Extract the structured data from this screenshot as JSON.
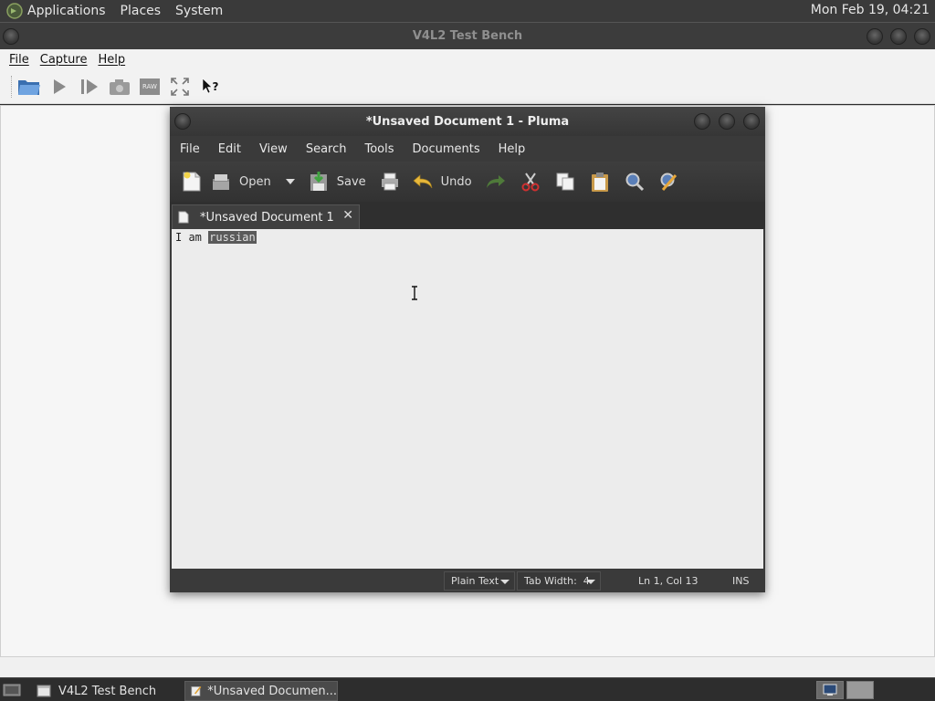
{
  "top_panel": {
    "applications": "Applications",
    "places": "Places",
    "system": "System",
    "clock": "Mon Feb 19, 04:21"
  },
  "v4l2": {
    "title": "V4L2 Test Bench",
    "menu": {
      "file": "File",
      "capture": "Capture",
      "help": "Help"
    },
    "toolbar_icons": [
      "open-folder-icon",
      "play-icon",
      "step-icon",
      "snapshot-camera-icon",
      "raw-icon",
      "fullscreen-icon",
      "whats-this-icon"
    ],
    "raw_label": "RAW"
  },
  "pluma": {
    "title": "*Unsaved Document 1 - Pluma",
    "menu": {
      "file": "File",
      "edit": "Edit",
      "view": "View",
      "search": "Search",
      "tools": "Tools",
      "documents": "Documents",
      "help": "Help"
    },
    "toolbar": {
      "open": "Open",
      "save": "Save",
      "undo": "Undo"
    },
    "tab": {
      "label": "*Unsaved Document 1",
      "close": "✕"
    },
    "editor": {
      "plain": "I am ",
      "selected": "russian"
    },
    "status": {
      "language": "Plain Text",
      "tab_width": "Tab Width:  4",
      "position": "Ln 1, Col 13",
      "mode": "INS"
    }
  },
  "taskbar": {
    "task1": "V4L2 Test Bench",
    "task2": "*Unsaved Documen..."
  },
  "colors": {
    "panel": "#3a3a3a",
    "pluma_bg": "#3a3a3a",
    "editor_bg": "#ececec",
    "selection": "#5a5a5a"
  }
}
